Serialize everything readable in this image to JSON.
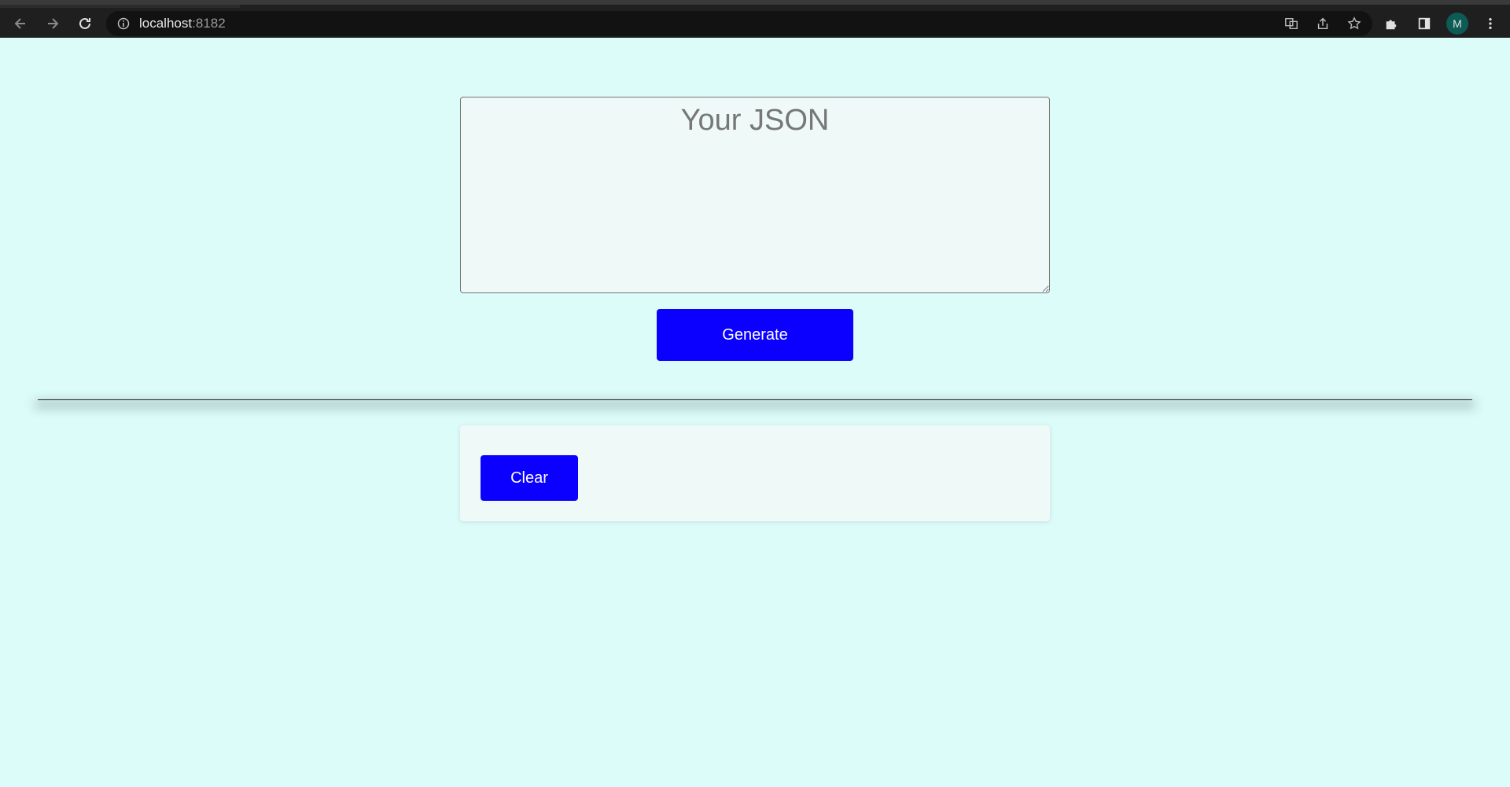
{
  "browser": {
    "url_host": "localhost",
    "url_port": ":8182",
    "avatar_initial": "M"
  },
  "editor": {
    "placeholder": "Your JSON",
    "value": ""
  },
  "actions": {
    "generate_label": "Generate",
    "clear_label": "Clear"
  },
  "colors": {
    "page_background": "#dcfcfa",
    "button_primary": "#0b00ff",
    "panel_background": "#eef9f8"
  }
}
